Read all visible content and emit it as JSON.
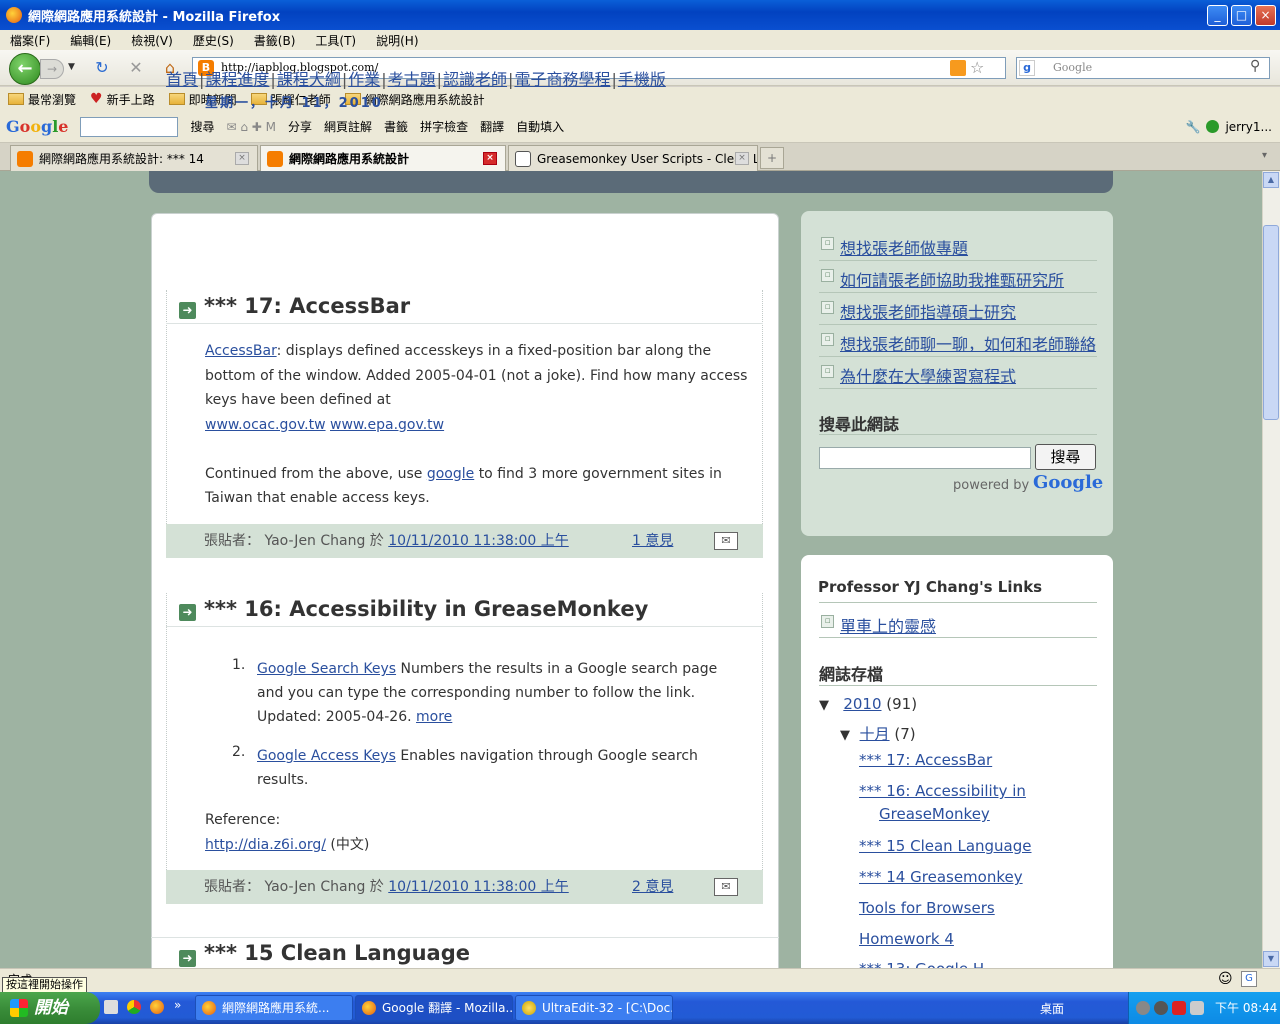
{
  "window": {
    "title": "網際網路應用系統設計 - Mozilla Firefox",
    "min": "_",
    "max": "□",
    "close": "×"
  },
  "menu": [
    "檔案(F)",
    "編輯(E)",
    "檢視(V)",
    "歷史(S)",
    "書籤(B)",
    "工具(T)",
    "說明(H)"
  ],
  "nav": {
    "url": "http://iapblog.blogspot.com/",
    "search_placeholder": "Google"
  },
  "bookmarks": [
    "最常瀏覽",
    "新手上路",
    "即時新聞",
    "張耀仁老師",
    "網際網路應用系統設計"
  ],
  "google_toolbar": {
    "logo": "Google",
    "items": [
      "搜尋",
      "分享",
      "網頁註解",
      "書籤",
      "拼字檢查",
      "翻譯",
      "自動填入"
    ],
    "user": "jerry1..."
  },
  "tabs": [
    {
      "label": "網際網路應用系統設計: *** 14"
    },
    {
      "label": "網際網路應用系統設計"
    },
    {
      "label": "Greasemonkey User Scripts - Clean Lan..."
    }
  ],
  "blog": {
    "navlinks": [
      "首頁",
      "課程進度",
      "課程大綱",
      "作業",
      "考古題",
      "認識老師",
      "電子商務學程",
      "手機版"
    ],
    "date": "星期一，十月 11，2010",
    "posts": [
      {
        "title": "*** 17: AccessBar",
        "link1": "AccessBar",
        "text1": ": displays defined accesskeys in a fixed-position bar along the bottom of the window. Added 2005-04-01 (not a joke). Find how many access keys have been defined at",
        "link2": "www.ocac.gov.tw",
        "link3": "www.epa.gov.tw",
        "text2a": "Continued from the above, use",
        "link4": "google",
        "text2b": "to find 3 more government sites in Taiwan that enable access keys.",
        "footer_prefix": "張貼者： Yao-Jen Chang 於",
        "footer_time": "10/11/2010 11:38:00 上午",
        "comments": "1 意見"
      },
      {
        "title": "*** 16: Accessibility in GreaseMonkey",
        "item1_link": "Google Search Keys",
        "item1_text": "Numbers the results in a Google search page and you can type the corresponding number to follow the link. Updated: 2005-04-26.",
        "item1_more": "more",
        "item2_link": "Google Access Keys",
        "item2_text": "Enables navigation through Google search results.",
        "ref_label": "Reference:",
        "ref_link": "http://dia.z6i.org/",
        "ref_suffix": "(中文)",
        "footer_prefix": "張貼者： Yao-Jen Chang 於",
        "footer_time": "10/11/2010 11:38:00 上午",
        "comments": "2 意見"
      },
      {
        "title": "*** 15 Clean Language"
      }
    ]
  },
  "sidebar": {
    "links": [
      "想找張老師做專題",
      "如何請張老師協助我推甄研究所",
      "想找張老師指導碩士研究",
      "想找張老師聊一聊，如何和老師聯絡",
      "為什麼在大學練習寫程式"
    ],
    "search_title": "搜尋此網誌",
    "search_button": "搜尋",
    "powered_by": "powered by",
    "powered_logo": "Google",
    "links_title": "Professor YJ Chang's Links",
    "links2": [
      "單車上的靈感"
    ],
    "archive_title": "網誌存檔",
    "year": "2010",
    "year_count": "(91)",
    "month": "十月",
    "month_count": "(7)",
    "archive_posts": [
      "*** 17: AccessBar",
      "*** 16: Accessibility in",
      "GreaseMonkey",
      "*** 15 Clean Language",
      "*** 14 Greasemonkey",
      "Tools for Browsers",
      "Homework 4",
      "*** 13: Google H..."
    ]
  },
  "status": {
    "text": "完成",
    "tooltip": "按這裡開始操作"
  },
  "taskbar": {
    "start": "開始",
    "items": [
      "網際網路應用系統...",
      "Google 翻譯 - Mozilla...",
      "UltraEdit-32 - [C:\\Doc..."
    ],
    "desktop": "桌面",
    "clock": "下午 08:44"
  }
}
